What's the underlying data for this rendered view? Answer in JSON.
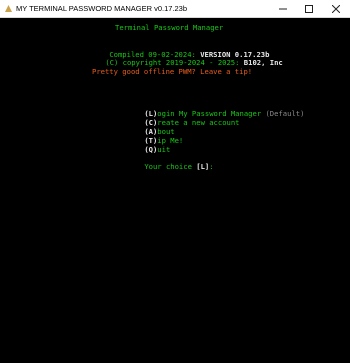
{
  "window": {
    "title": "MY TERMINAL PASSWORD MANAGER  v0.17.23b",
    "minimize_glyph": "—",
    "maximize_glyph": "☐",
    "close_glyph": "✕"
  },
  "header": {
    "app_name": "Terminal Password Manager",
    "compiled_prefix": "Compiled 09-02-2024: ",
    "version": "VERSION 0.17.23b",
    "copyright_prefix": "(C) copyright 2019-2024 - 2025: ",
    "company": "B102, Inc",
    "tip_banner": "Pretty good offline PWM? Leave a tip!"
  },
  "menu": {
    "items": [
      {
        "key": "(L)",
        "label": "ogin My Password Manager",
        "suffix": " (Default)"
      },
      {
        "key": "(C)",
        "label": "reate a new account",
        "suffix": ""
      },
      {
        "key": "(A)",
        "label": "bout",
        "suffix": ""
      },
      {
        "key": "(T)",
        "label": "ip Me!",
        "suffix": ""
      },
      {
        "key": "(Q)",
        "label": "uit",
        "suffix": ""
      }
    ],
    "prompt_label": "Your choice ",
    "prompt_default": "[L]",
    "prompt_colon": ":"
  },
  "colors": {
    "terminal_bg": "#000000",
    "text_green": "#18c818",
    "text_orange": "#e85c1c",
    "text_white": "#e8e8e8",
    "text_gray": "#8a8a8a"
  }
}
